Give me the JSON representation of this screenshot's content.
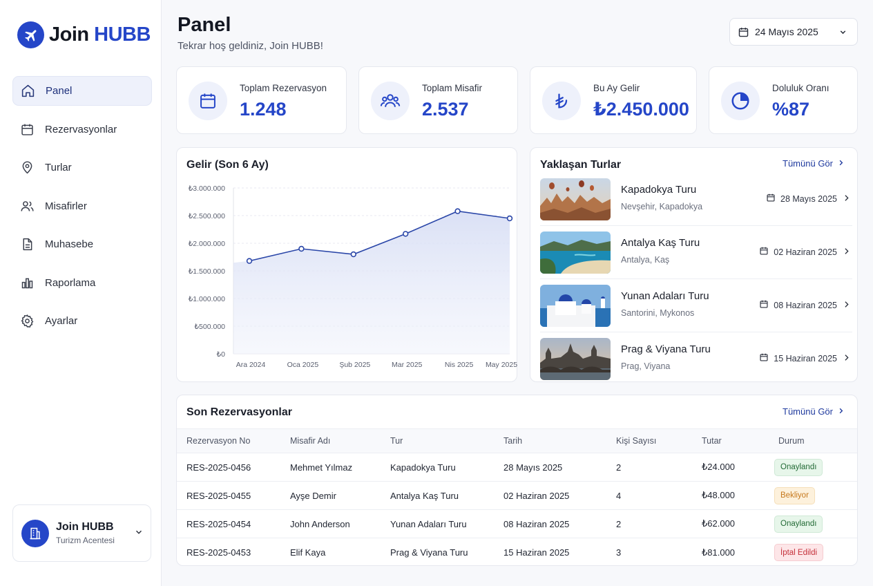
{
  "brand": {
    "name_a": "Join ",
    "name_b": "HUBB"
  },
  "sidebar": {
    "items": [
      {
        "label": "Panel",
        "icon": "home-icon"
      },
      {
        "label": "Rezervasyonlar",
        "icon": "calendar-icon"
      },
      {
        "label": "Turlar",
        "icon": "map-pin-icon"
      },
      {
        "label": "Misafirler",
        "icon": "users-icon"
      },
      {
        "label": "Muhasebe",
        "icon": "document-icon"
      },
      {
        "label": "Raporlama",
        "icon": "bar-chart-icon"
      },
      {
        "label": "Ayarlar",
        "icon": "gear-icon"
      }
    ],
    "active": "Panel"
  },
  "account": {
    "name": "Join HUBB",
    "role": "Turizm Acentesi"
  },
  "header": {
    "title": "Panel",
    "subtitle": "Tekrar hoş geldiniz, Join HUBB!",
    "date": "24 Mayıs 2025"
  },
  "stats": [
    {
      "label": "Toplam Rezervasyon",
      "value": "1.248",
      "icon": "calendar-icon"
    },
    {
      "label": "Toplam Misafir",
      "value": "2.537",
      "icon": "users-icon"
    },
    {
      "label": "Bu Ay Gelir",
      "value": "₺2.450.000",
      "icon": "lira-icon"
    },
    {
      "label": "Doluluk Oranı",
      "value": "%87",
      "icon": "pie-chart-icon"
    }
  ],
  "revenue": {
    "title": "Gelir (Son 6 Ay)"
  },
  "chart_data": {
    "type": "area",
    "title": "Gelir (Son 6 Ay)",
    "categories": [
      "Ara 2024",
      "Oca 2025",
      "Şub 2025",
      "Mar 2025",
      "Nis 2025",
      "May 2025"
    ],
    "series": [
      {
        "values": [
          1680000,
          1900000,
          1800000,
          2170000,
          2580000,
          2450000
        ]
      }
    ],
    "ylim": [
      0,
      3000000
    ],
    "yticks": [
      0,
      500000,
      1000000,
      1500000,
      2000000,
      2500000,
      3000000
    ],
    "ytick_labels": [
      "₺0",
      "₺500.000",
      "₺1.000.000",
      "₺1.500.000",
      "₺2.000.000",
      "₺2.500.000",
      "₺3.000.000"
    ],
    "grid": true,
    "color": "#2a46a8"
  },
  "tours": {
    "title": "Yaklaşan Turlar",
    "see_all": "Tümünü Gör",
    "items": [
      {
        "name": "Kapadokya Turu",
        "location": "Nevşehir, Kapadokya",
        "date": "28 Mayıs 2025"
      },
      {
        "name": "Antalya Kaş Turu",
        "location": "Antalya, Kaş",
        "date": "02 Haziran 2025"
      },
      {
        "name": "Yunan Adaları Turu",
        "location": "Santorini, Mykonos",
        "date": "08 Haziran 2025"
      },
      {
        "name": "Prag & Viyana Turu",
        "location": "Prag, Viyana",
        "date": "15 Haziran 2025"
      }
    ]
  },
  "reservations": {
    "title": "Son Rezervasyonlar",
    "see_all": "Tümünü Gör",
    "columns": [
      "Rezervasyon No",
      "Misafir Adı",
      "Tur",
      "Tarih",
      "Kişi Sayısı",
      "Tutar",
      "Durum"
    ],
    "rows": [
      {
        "no": "RES-2025-0456",
        "guest": "Mehmet Yılmaz",
        "tour": "Kapadokya Turu",
        "date": "28 Mayıs 2025",
        "pax": "2",
        "amount": "₺24.000",
        "status": "Onaylandı",
        "status_color": "#226a35"
      },
      {
        "no": "RES-2025-0455",
        "guest": "Ayşe Demir",
        "tour": "Antalya Kaş Turu",
        "date": "02 Haziran 2025",
        "pax": "4",
        "amount": "₺48.000",
        "status": "Bekliyor",
        "status_color": "#c6781c"
      },
      {
        "no": "RES-2025-0454",
        "guest": "John Anderson",
        "tour": "Yunan Adaları Turu",
        "date": "08 Haziran 2025",
        "pax": "2",
        "amount": "₺62.000",
        "status": "Onaylandı",
        "status_color": "#226a35"
      },
      {
        "no": "RES-2025-0453",
        "guest": "Elif Kaya",
        "tour": "Prag & Viyana Turu",
        "date": "15 Haziran 2025",
        "pax": "3",
        "amount": "₺81.000",
        "status": "İptal Edildi",
        "status_color": "#c5303a"
      }
    ]
  }
}
